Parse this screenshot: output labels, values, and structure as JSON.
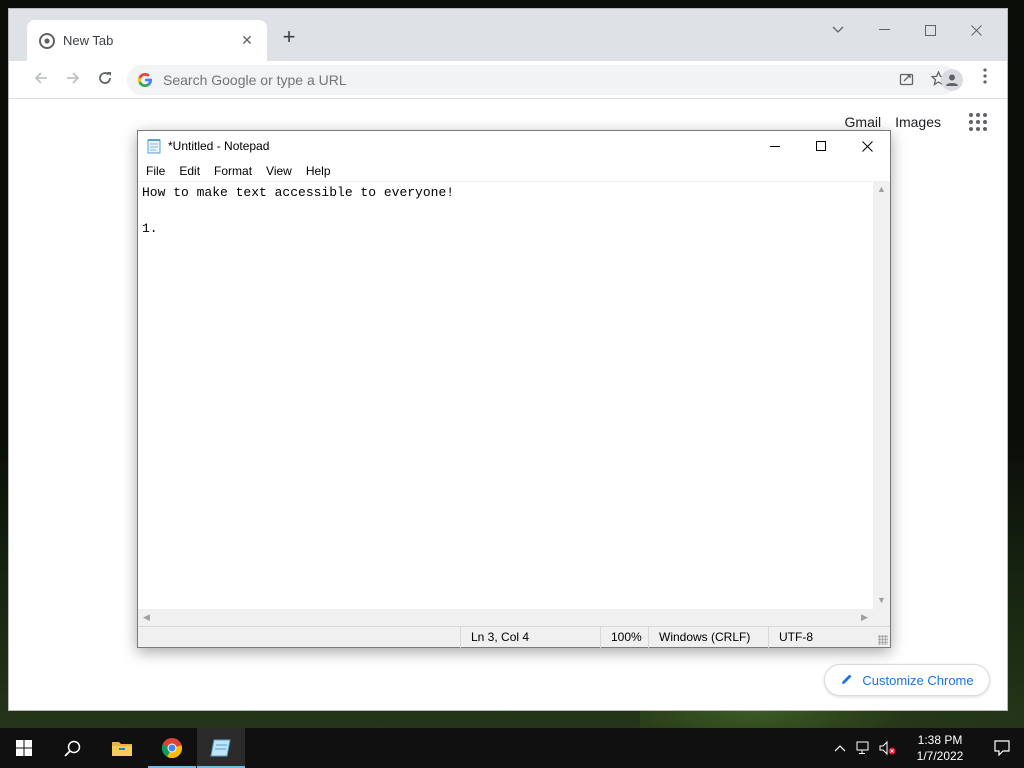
{
  "chrome": {
    "tab_title": "New Tab",
    "tab_close": "✕",
    "new_tab": "+",
    "omnibox_placeholder": "Search Google or type a URL",
    "ntp_links": [
      "Gmail",
      "Images"
    ],
    "customize_label": "Customize Chrome",
    "accent_color": "#1a73e8"
  },
  "notepad": {
    "title": "*Untitled - Notepad",
    "menu": [
      "File",
      "Edit",
      "Format",
      "View",
      "Help"
    ],
    "content": "How to make text accessible to everyone!\n\n1. ",
    "status": {
      "position": "Ln 3, Col 4",
      "zoom": "100%",
      "line_ending": "Windows (CRLF)",
      "encoding": "UTF-8"
    }
  },
  "taskbar": {
    "clock_time": "1:38 PM",
    "clock_date": "1/7/2022",
    "apps": [
      "start-icon",
      "search-icon",
      "file-explorer-icon",
      "chrome-icon",
      "notepad-icon"
    ],
    "underline_color": "#76b9ed"
  }
}
